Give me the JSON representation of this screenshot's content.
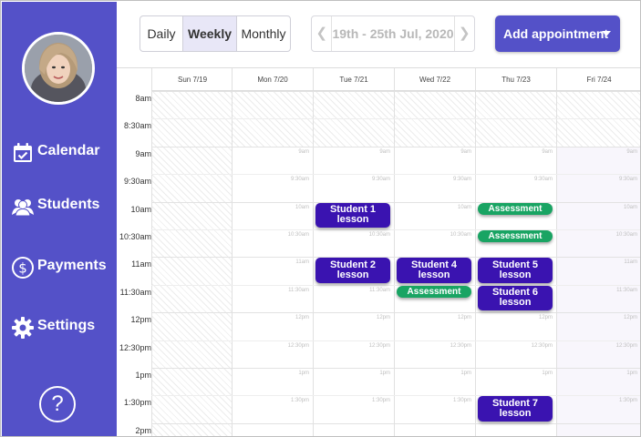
{
  "sidebar": {
    "items": [
      {
        "label": "Calendar",
        "icon": "calendar-icon"
      },
      {
        "label": "Students",
        "icon": "students-icon"
      },
      {
        "label": "Payments",
        "icon": "dollar-icon"
      },
      {
        "label": "Settings",
        "icon": "gear-icon"
      }
    ],
    "help_label": "?"
  },
  "toolbar": {
    "views": {
      "daily": "Daily",
      "weekly": "Weekly",
      "monthly": "Monthly"
    },
    "active_view": "Weekly",
    "date_range": "19th - 25th Jul, 2020",
    "add_label": "Add appointment"
  },
  "calendar": {
    "days": [
      "Sun 7/19",
      "Mon 7/20",
      "Tue 7/21",
      "Wed 7/22",
      "Thu 7/23",
      "Fri 7/24"
    ],
    "times": [
      "8am",
      "8:30am",
      "9am",
      "9:30am",
      "10am",
      "10:30am",
      "11am",
      "11:30am",
      "12pm",
      "12:30pm",
      "1pm",
      "1:30pm",
      "2pm"
    ],
    "slot_labels": [
      "9am",
      "9:30am",
      "10am",
      "10:30am",
      "11am",
      "11:30am",
      "12pm",
      "12:30pm",
      "1pm",
      "1:30pm"
    ],
    "events": [
      {
        "day": 2,
        "start": "10:00",
        "end": "10:30",
        "title": "Student 1 lesson",
        "kind": "lesson"
      },
      {
        "day": 2,
        "start": "11:00",
        "end": "11:30",
        "title": "Student 2 lesson",
        "kind": "lesson"
      },
      {
        "day": 3,
        "start": "11:00",
        "end": "11:30",
        "title": "Student 4 lesson",
        "kind": "lesson"
      },
      {
        "day": 3,
        "start": "11:30",
        "end": "11:45",
        "title": "Assessment",
        "kind": "assessment"
      },
      {
        "day": 4,
        "start": "10:00",
        "end": "10:15",
        "title": "Assessment",
        "kind": "assessment"
      },
      {
        "day": 4,
        "start": "10:30",
        "end": "10:45",
        "title": "Assessment",
        "kind": "assessment"
      },
      {
        "day": 4,
        "start": "11:00",
        "end": "11:30",
        "title": "Student 5 lesson",
        "kind": "lesson"
      },
      {
        "day": 4,
        "start": "11:30",
        "end": "12:00",
        "title": "Student 6 lesson",
        "kind": "lesson"
      },
      {
        "day": 4,
        "start": "13:30",
        "end": "14:00",
        "title": "Student 7 lesson",
        "kind": "lesson"
      }
    ]
  },
  "colors": {
    "sidebar": "#5451c8",
    "lesson": "#3a13b0",
    "assessment": "#19a463"
  }
}
